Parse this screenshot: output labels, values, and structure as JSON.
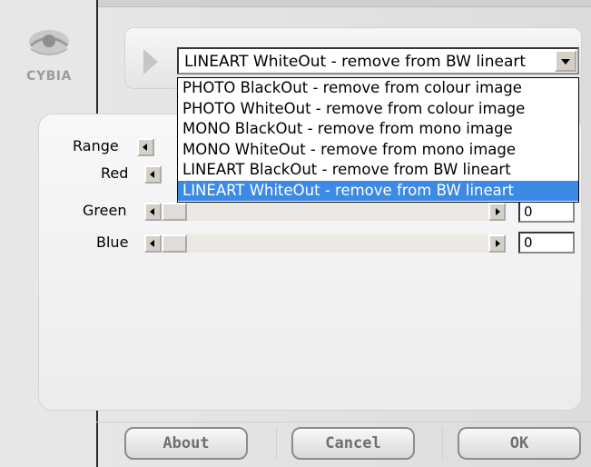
{
  "logo": {
    "text": "CYBIA"
  },
  "mode_select": {
    "value": "LINEART WhiteOut - remove from BW lineart",
    "options": [
      "PHOTO BlackOut - remove from colour image",
      "PHOTO WhiteOut - remove from colour image",
      "MONO BlackOut - remove from mono image",
      "MONO WhiteOut - remove from mono image",
      "LINEART BlackOut - remove from BW lineart",
      "LINEART WhiteOut - remove from BW lineart"
    ],
    "selected_index": 5
  },
  "sliders": [
    {
      "label": "Range",
      "value": ""
    },
    {
      "label": "Red",
      "value": ""
    },
    {
      "label": "Green",
      "value": "0"
    },
    {
      "label": "Blue",
      "value": "0"
    }
  ],
  "buttons": {
    "about": "About",
    "cancel": "Cancel",
    "ok": "OK"
  },
  "colors": {
    "highlight": "#3c89e6",
    "frame": "#2a2a2a"
  }
}
